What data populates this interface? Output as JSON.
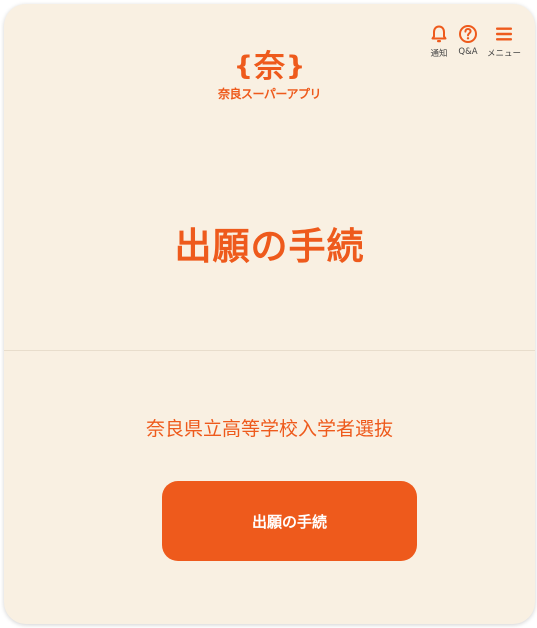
{
  "header": {
    "logo_mark": "奈",
    "logo_text": "奈良スーパーアプリ",
    "nav": [
      {
        "label": "通知",
        "icon": "bell-icon"
      },
      {
        "label": "Q&A",
        "icon": "question-circle-icon"
      },
      {
        "label": "メニュー",
        "icon": "hamburger-menu-icon"
      }
    ]
  },
  "main": {
    "title": "出願の手続",
    "subtitle": "奈良県立高等学校入学者選抜",
    "button_label": "出願の手続"
  },
  "colors": {
    "accent": "#ee5a1c",
    "background": "#f9f0e2"
  }
}
